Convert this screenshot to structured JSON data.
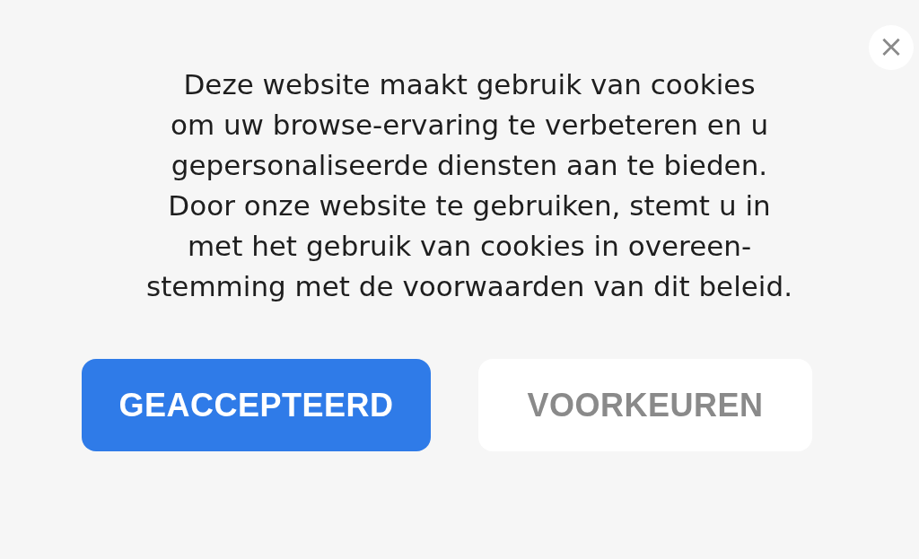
{
  "close_button": {
    "label": "×"
  },
  "message": "Deze website maakt gebruik van cookies\nom uw browse-ervaring te verbeteren en u\ngepersonaliseerde diensten aan te bieden.\nDoor onze website te gebruiken, stemt u in\nmet het gebruik van cookies in overeen-\nstemming met de voorwaarden van dit beleid.",
  "buttons": [
    {
      "label": "GEACCEPTEERD",
      "kind": "primary"
    },
    {
      "label": "VOORKEUREN",
      "kind": "secondary"
    }
  ]
}
